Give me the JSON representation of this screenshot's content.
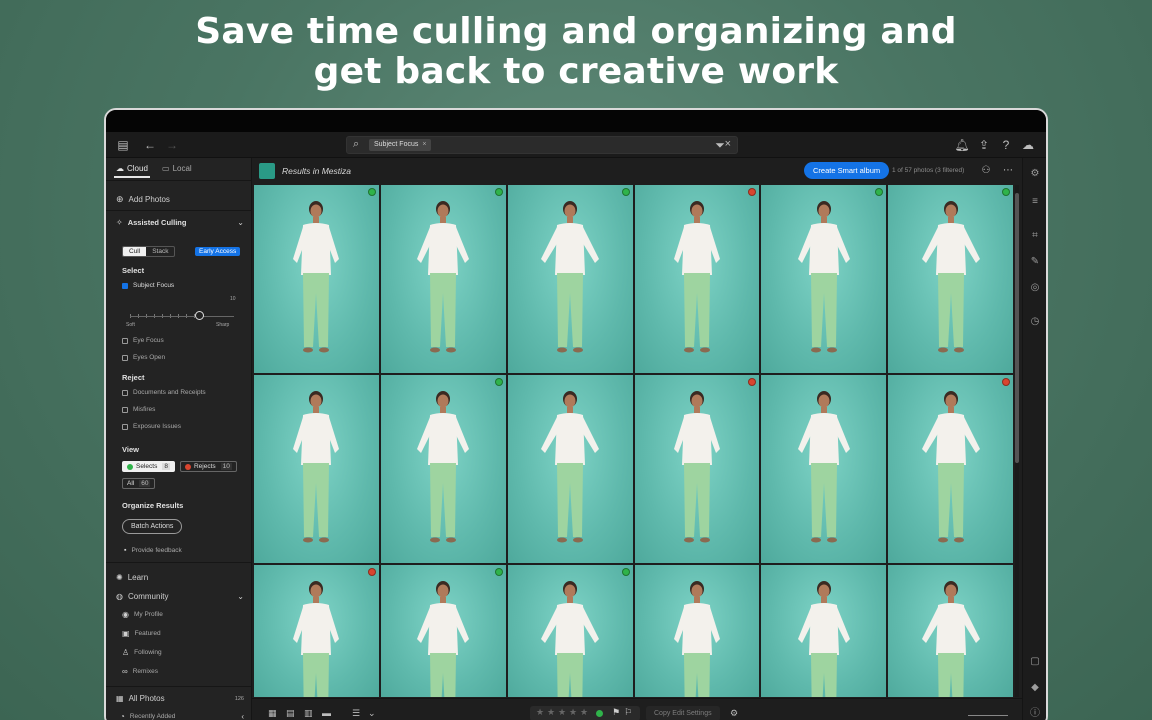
{
  "headline": {
    "line1": "Save time culling and organizing and",
    "line2": "get back to creative work"
  },
  "topbar": {
    "search_chip": "Subject Focus",
    "icons": [
      "panel-toggle-icon",
      "back-arrow-icon",
      "forward-arrow-icon",
      "search-icon",
      "filter-icon",
      "bell-icon",
      "share-icon",
      "help-icon",
      "cloud-icon"
    ]
  },
  "sidebar": {
    "tabs": [
      {
        "label": "Cloud",
        "active": true
      },
      {
        "label": "Local",
        "active": false
      }
    ],
    "add_photos": "Add Photos",
    "assisted_culling": "Assisted Culling",
    "segment": [
      "Cull",
      "Stack"
    ],
    "early_access": "Early Access",
    "select_heading": "Select",
    "subject_focus": "Subject Focus",
    "slider_max": "10",
    "slider_soft": "Soft",
    "slider_sharp": "Sharp",
    "eye_focus": "Eye Focus",
    "eyes_open": "Eyes Open",
    "reject_heading": "Reject",
    "reject_items": [
      "Documents and Receipts",
      "Misfires",
      "Exposure Issues"
    ],
    "view_heading": "View",
    "selects_label": "Selects",
    "selects_count": "8",
    "rejects_label": "Rejects",
    "rejects_count": "10",
    "all_label": "All",
    "all_count": "60",
    "organize_heading": "Organize Results",
    "batch_actions": "Batch Actions",
    "provide_feedback": "Provide feedback",
    "learn": "Learn",
    "community": "Community",
    "community_items": [
      "My Profile",
      "Featured",
      "Following",
      "Remixes"
    ],
    "all_photos": "All Photos",
    "all_photos_count": "126",
    "recently_added": "Recently Added"
  },
  "main": {
    "results_prefix": "Results in",
    "album_name": "Mestiza",
    "create_smart_album": "Create Smart album",
    "photo_count": "1 of 57 photos  (3 filtered)"
  },
  "colors": {
    "accent": "#1473e6",
    "select_flag": "#2fb34a",
    "reject_flag": "#d9452f",
    "backdrop": "#69c3b6"
  },
  "grid": {
    "rows": [
      [
        "select",
        "select",
        "select",
        "reject",
        "select",
        "select"
      ],
      [
        "none",
        "select",
        "none",
        "reject",
        "none",
        "reject"
      ],
      [
        "reject",
        "select",
        "select",
        "none",
        "none",
        "none"
      ]
    ]
  },
  "bottombar": {
    "copy_edit_settings": "Copy Edit Settings",
    "star_count": 5
  }
}
